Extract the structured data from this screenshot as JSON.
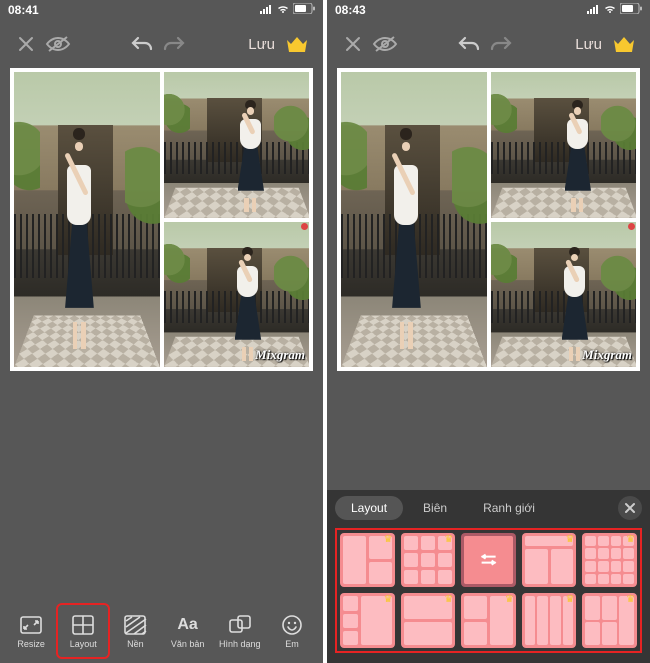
{
  "left": {
    "time": "08:41",
    "save": "Lưu",
    "watermark": "Mixgram",
    "tools": [
      {
        "icon": "resize",
        "label": "Resize"
      },
      {
        "icon": "layout",
        "label": "Layout"
      },
      {
        "icon": "background",
        "label": "Nền"
      },
      {
        "icon": "text",
        "label": "Văn bản"
      },
      {
        "icon": "shape",
        "label": "Hình dạng"
      },
      {
        "icon": "emoji",
        "label": "Em"
      }
    ],
    "selected_tool_index": 1
  },
  "right": {
    "time": "08:43",
    "save": "Lưu",
    "watermark": "Mixgram",
    "panel": {
      "tabs": [
        "Layout",
        "Biên",
        "Ranh giới"
      ],
      "active_tab_index": 0,
      "selected_layout_index": 2,
      "layouts": [
        {
          "type": "cols2_rightsplit",
          "premium": true
        },
        {
          "type": "grid3x3",
          "premium": true
        },
        {
          "type": "single",
          "premium": false
        },
        {
          "type": "headerbody",
          "premium": true
        },
        {
          "type": "grid4x4",
          "premium": true
        },
        {
          "type": "sidebar3",
          "premium": true
        },
        {
          "type": "stack2",
          "premium": true
        },
        {
          "type": "l2r1",
          "premium": true
        },
        {
          "type": "cols4",
          "premium": true
        },
        {
          "type": "grid2x2_sidebar",
          "premium": true
        }
      ]
    }
  }
}
